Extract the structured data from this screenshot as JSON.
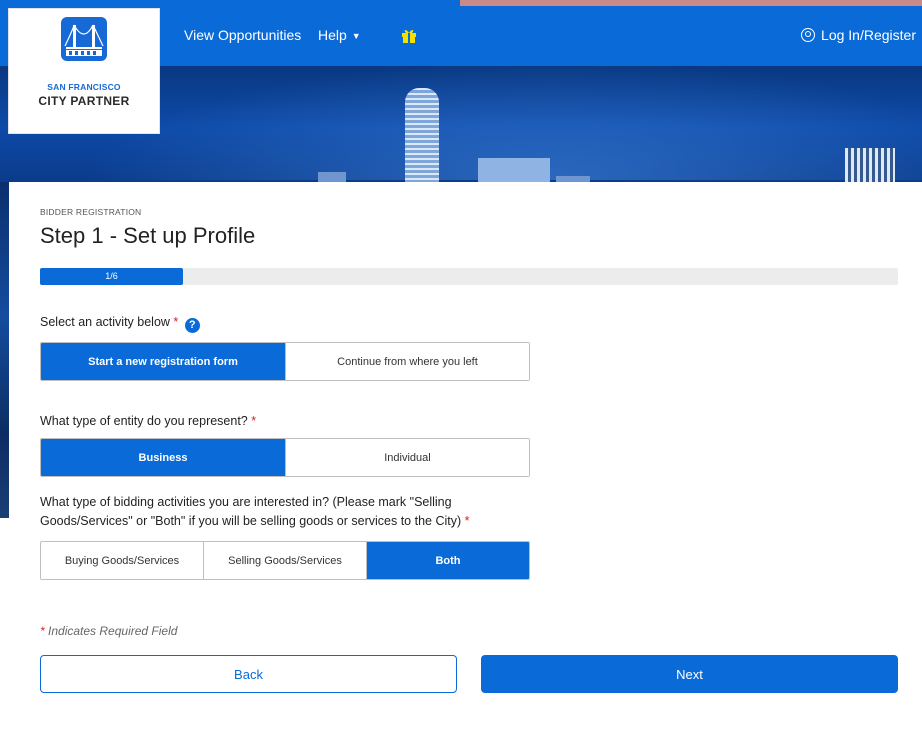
{
  "nav": {
    "view_opportunities": "View Opportunities",
    "help": "Help",
    "login": "Log In/Register",
    "icons": {
      "gift": "gift-icon",
      "user": "user-circle-icon",
      "caret": "chevron-down-icon"
    }
  },
  "logo": {
    "subtitle": "SAN FRANCISCO",
    "name": "CITY PARTNER",
    "icon": "bridge-logo-icon"
  },
  "page": {
    "breadcrumb": "BIDDER REGISTRATION",
    "title": "Step 1 - Set up Profile"
  },
  "progress": {
    "label": "1/6",
    "current": 1,
    "total": 6
  },
  "activity": {
    "label": "Select an activity below",
    "required_mark": "*",
    "help_icon": "question-circle-icon",
    "options": [
      "Start a new registration form",
      "Continue from where you left"
    ],
    "selected": "Start a new registration form"
  },
  "entity": {
    "label": "What type of entity do you represent?",
    "required_mark": "*",
    "options": [
      "Business",
      "Individual"
    ],
    "selected": "Business"
  },
  "bidding": {
    "label": "What type of bidding activities you are interested in? (Please mark \"Selling Goods/Services\" or \"Both\" if you will be selling goods or services to the City)",
    "required_mark": "*",
    "options": [
      "Buying Goods/Services",
      "Selling Goods/Services",
      "Both"
    ],
    "selected": "Both"
  },
  "footer": {
    "required_mark": "*",
    "required_note": "Indicates Required Field",
    "back": "Back",
    "next": "Next"
  },
  "colors": {
    "primary": "#0a6bd8",
    "required": "#d92020"
  }
}
